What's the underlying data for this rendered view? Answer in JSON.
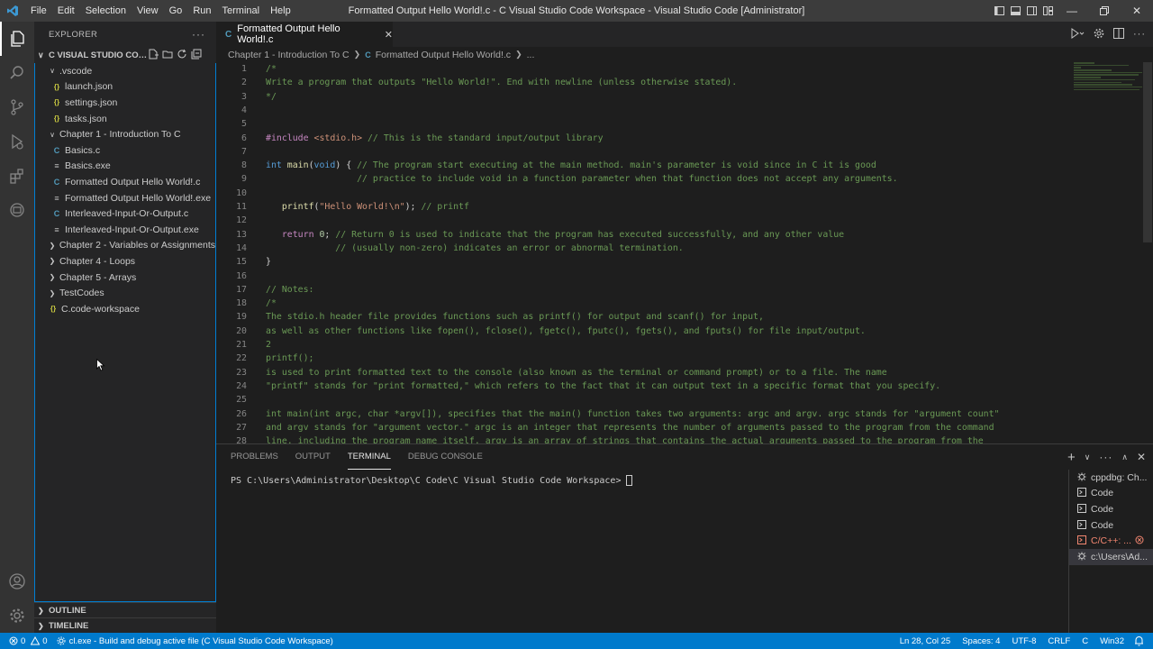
{
  "titlebar": {
    "menu": [
      "File",
      "Edit",
      "Selection",
      "View",
      "Go",
      "Run",
      "Terminal",
      "Help"
    ],
    "title": "Formatted Output Hello World!.c - C Visual Studio Code Workspace - Visual Studio Code [Administrator]"
  },
  "sidebar": {
    "header": "EXPLORER",
    "workspace_title": "C VISUAL STUDIO CODE...",
    "tree": [
      {
        "label": ".vscode",
        "type": "folder",
        "indent": 1,
        "open": true
      },
      {
        "label": "launch.json",
        "type": "json",
        "indent": 2
      },
      {
        "label": "settings.json",
        "type": "json",
        "indent": 2
      },
      {
        "label": "tasks.json",
        "type": "json",
        "indent": 2
      },
      {
        "label": "Chapter 1 - Introduction To C",
        "type": "folder",
        "indent": 1,
        "open": true
      },
      {
        "label": "Basics.c",
        "type": "c",
        "indent": 2
      },
      {
        "label": "Basics.exe",
        "type": "exe",
        "indent": 2
      },
      {
        "label": "Formatted Output Hello World!.c",
        "type": "c",
        "indent": 2
      },
      {
        "label": "Formatted Output Hello World!.exe",
        "type": "exe",
        "indent": 2
      },
      {
        "label": "Interleaved-Input-Or-Output.c",
        "type": "c",
        "indent": 2
      },
      {
        "label": "Interleaved-Input-Or-Output.exe",
        "type": "exe",
        "indent": 2
      },
      {
        "label": "Chapter 2 - Variables or Assignments",
        "type": "folder",
        "indent": 1,
        "open": false
      },
      {
        "label": "Chapter 4 - Loops",
        "type": "folder",
        "indent": 1,
        "open": false
      },
      {
        "label": "Chapter 5 - Arrays",
        "type": "folder",
        "indent": 1,
        "open": false
      },
      {
        "label": "TestCodes",
        "type": "folder",
        "indent": 1,
        "open": false
      },
      {
        "label": "C.code-workspace",
        "type": "json",
        "indent": 1
      }
    ],
    "outline": "OUTLINE",
    "timeline": "TIMELINE"
  },
  "editor": {
    "tab_label": "Formatted Output Hello World!.c",
    "breadcrumb_folder": "Chapter 1 - Introduction To C",
    "breadcrumb_file": "Formatted Output Hello World!.c",
    "breadcrumb_more": "...",
    "lines": [
      {
        "n": "1",
        "t": "/*",
        "k": "cm"
      },
      {
        "n": "2",
        "t": "Write a program that outputs \"Hello World!\". End with newline (unless otherwise stated).",
        "k": "cm"
      },
      {
        "n": "3",
        "t": "*/",
        "k": "cm"
      },
      {
        "n": "4",
        "t": "",
        "k": "cm"
      },
      {
        "n": "5",
        "t": "",
        "k": "cm"
      },
      {
        "n": "6",
        "t": "#include <stdio.h> // This is the standard input/output library",
        "k": "inc"
      },
      {
        "n": "7",
        "t": "",
        "k": "cm"
      },
      {
        "n": "8",
        "t": "int main(void) { // The program start executing at the main method. main's parameter is void since in C it is good",
        "k": "main"
      },
      {
        "n": "9",
        "t": "                 // practice to include void in a function parameter when that function does not accept any arguments.",
        "k": "cm"
      },
      {
        "n": "10",
        "t": "",
        "k": "cm"
      },
      {
        "n": "11",
        "t": "   printf(\"Hello World!\\n\"); // printf",
        "k": "printf"
      },
      {
        "n": "12",
        "t": "",
        "k": "cm"
      },
      {
        "n": "13",
        "t": "   return 0; // Return 0 is used to indicate that the program has executed successfully, and any other value",
        "k": "ret"
      },
      {
        "n": "14",
        "t": "             // (usually non-zero) indicates an error or abnormal termination.",
        "k": "cm"
      },
      {
        "n": "15",
        "t": "}",
        "k": "plain"
      },
      {
        "n": "16",
        "t": "",
        "k": "cm"
      },
      {
        "n": "17",
        "t": "// Notes:",
        "k": "cm"
      },
      {
        "n": "18",
        "t": "/*",
        "k": "cm"
      },
      {
        "n": "19",
        "t": "The stdio.h header file provides functions such as printf() for output and scanf() for input,",
        "k": "cm"
      },
      {
        "n": "20",
        "t": "as well as other functions like fopen(), fclose(), fgetc(), fputc(), fgets(), and fputs() for file input/output.",
        "k": "cm"
      },
      {
        "n": "21",
        "t": "2",
        "k": "cm"
      },
      {
        "n": "22",
        "t": "printf();",
        "k": "cm"
      },
      {
        "n": "23",
        "t": "is used to print formatted text to the console (also known as the terminal or command prompt) or to a file. The name",
        "k": "cm"
      },
      {
        "n": "24",
        "t": "\"printf\" stands for \"print formatted,\" which refers to the fact that it can output text in a specific format that you specify.",
        "k": "cm"
      },
      {
        "n": "25",
        "t": "",
        "k": "cm"
      },
      {
        "n": "26",
        "t": "int main(int argc, char *argv[]), specifies that the main() function takes two arguments: argc and argv. argc stands for \"argument count\"",
        "k": "cm"
      },
      {
        "n": "27",
        "t": "and argv stands for \"argument vector.\" argc is an integer that represents the number of arguments passed to the program from the command",
        "k": "cm"
      },
      {
        "n": "28",
        "t": "line, including the program name itself. argv is an array of strings that contains the actual arguments passed to the program from the",
        "k": "cm"
      }
    ]
  },
  "panel": {
    "tabs": [
      "PROBLEMS",
      "OUTPUT",
      "TERMINAL",
      "DEBUG CONSOLE"
    ],
    "active_tab": "TERMINAL",
    "prompt": "PS C:\\Users\\Administrator\\Desktop\\C Code\\C Visual Studio Code Workspace>",
    "terminals": [
      {
        "label": "cppdbg: Ch...",
        "icon": "debug"
      },
      {
        "label": "Code",
        "icon": "terminal"
      },
      {
        "label": "Code",
        "icon": "terminal"
      },
      {
        "label": "Code",
        "icon": "terminal"
      },
      {
        "label": "C/C++: ...",
        "icon": "terminal",
        "error": true
      },
      {
        "label": "c:\\Users\\Ad...",
        "icon": "debug",
        "selected": true
      }
    ]
  },
  "statusbar": {
    "errors": "0",
    "warnings": "0",
    "task": "cl.exe - Build and debug active file (C Visual Studio Code Workspace)",
    "position": "Ln 28, Col 25",
    "spaces": "Spaces: 4",
    "encoding": "UTF-8",
    "eol": "CRLF",
    "language": "C",
    "platform": "Win32"
  },
  "colors": {
    "accent": "#007acc",
    "comment": "#6a9955",
    "keyword": "#569cd6",
    "function": "#dcdcaa",
    "string": "#ce9178"
  }
}
